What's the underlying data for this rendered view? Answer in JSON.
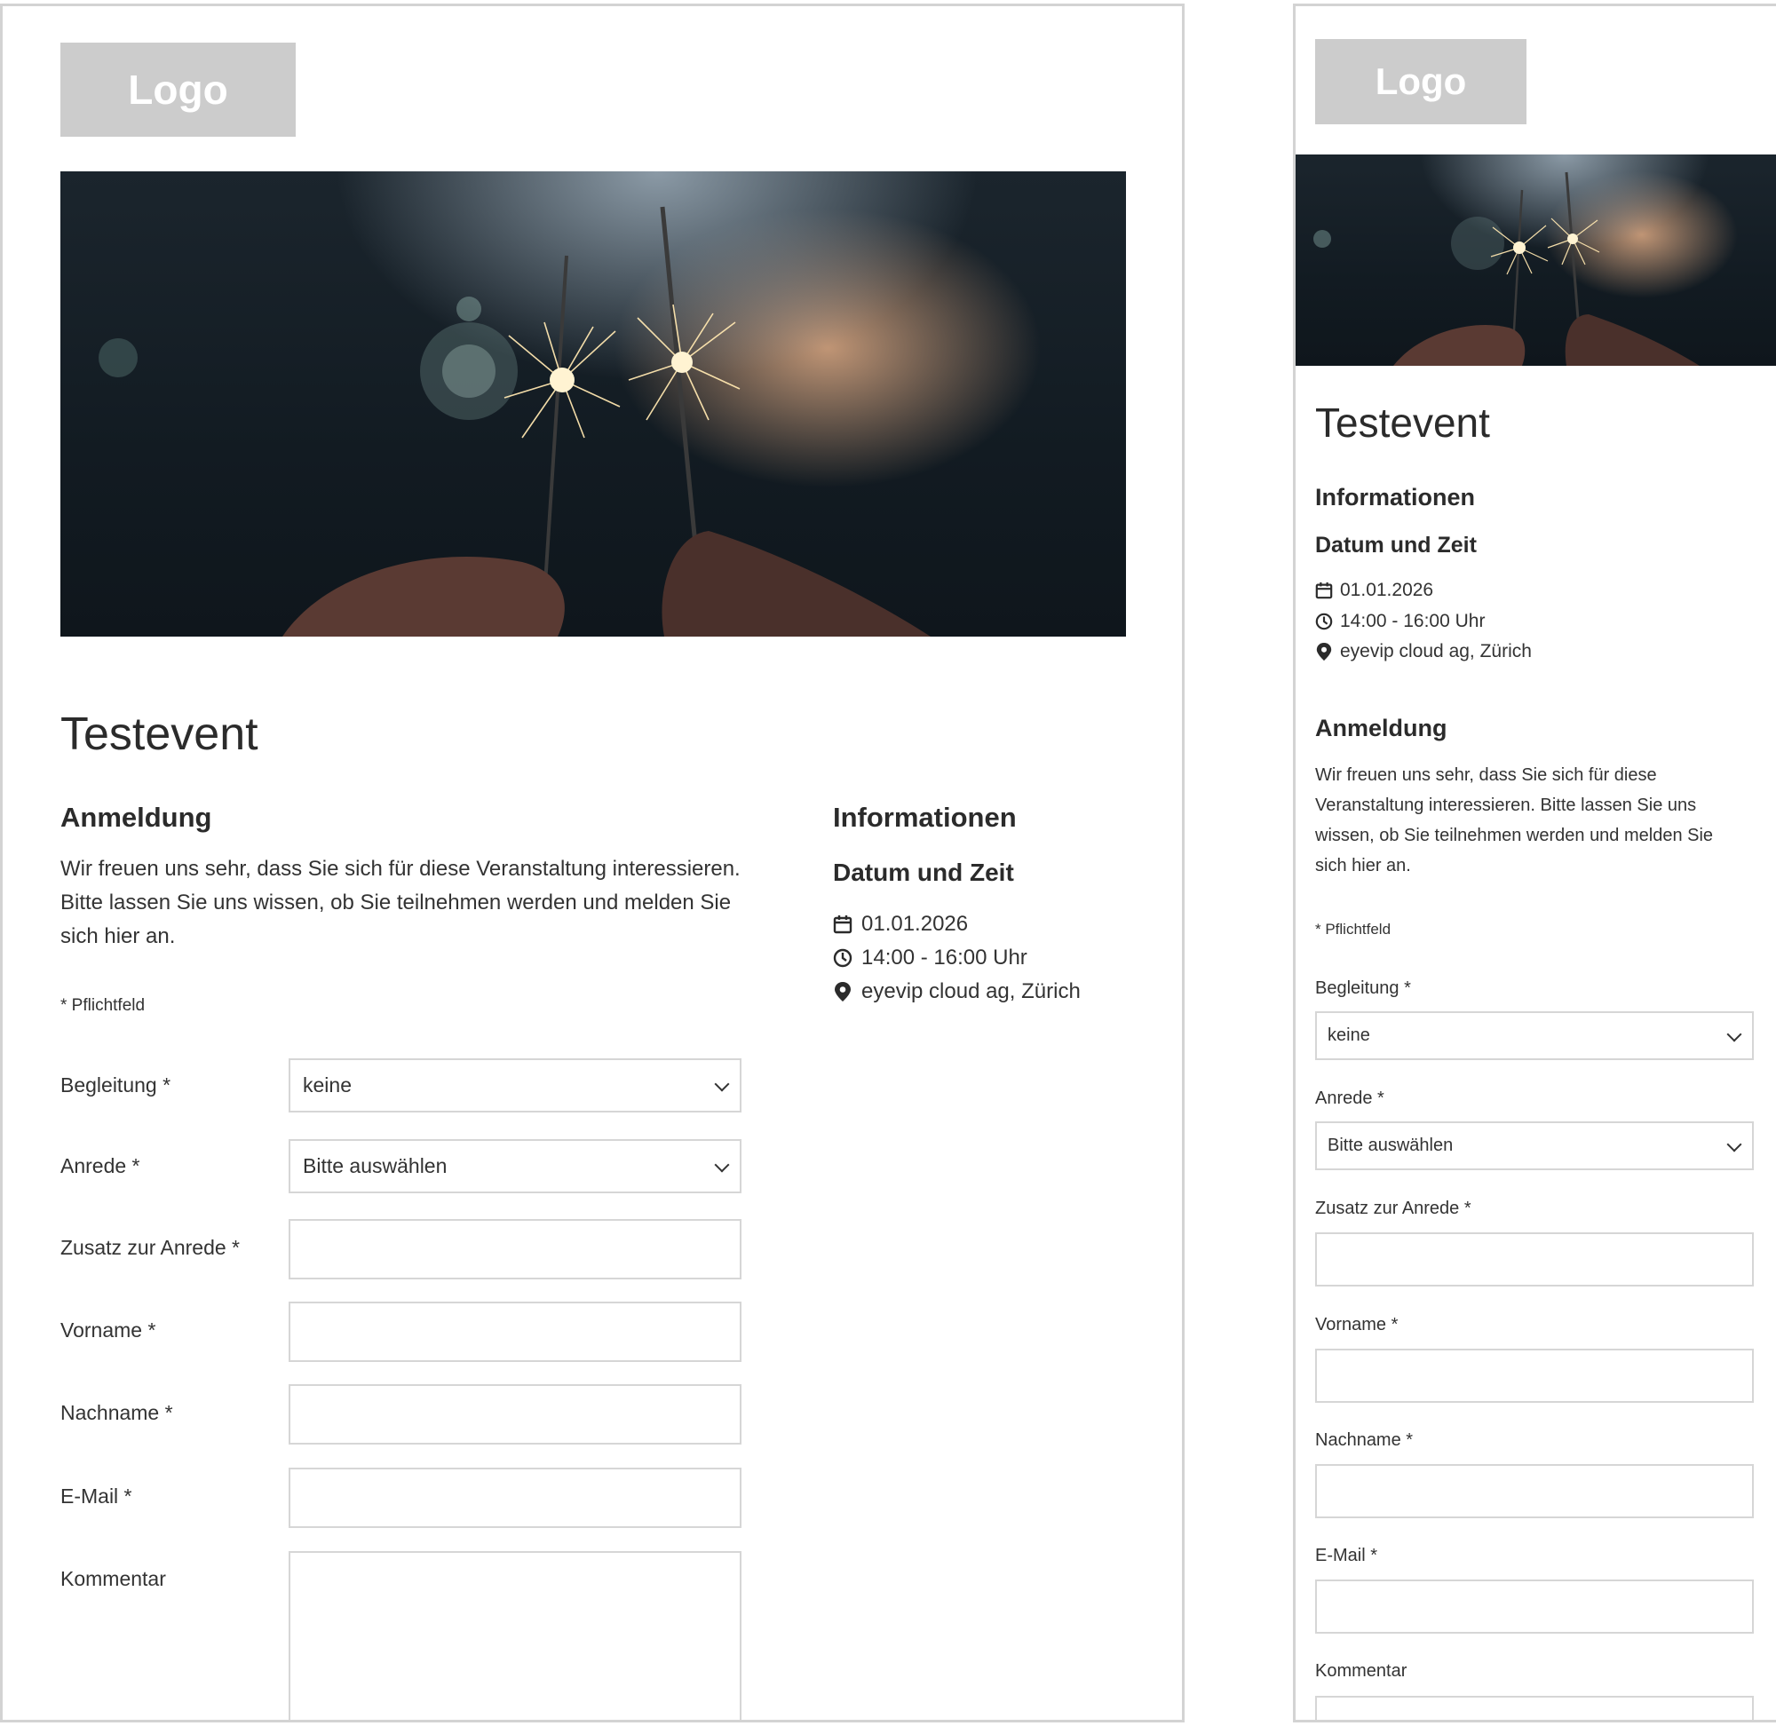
{
  "logo": {
    "text": "Logo"
  },
  "event": {
    "title": "Testevent"
  },
  "registration": {
    "heading": "Anmeldung",
    "text_desktop_lines": [
      "Wir freuen uns sehr, dass Sie sich für diese Veranstaltung interessieren.",
      "Bitte lassen Sie uns wissen, ob Sie teilnehmen werden und melden Sie",
      "sich hier an."
    ],
    "text_mobile_lines": [
      "Wir freuen uns sehr, dass Sie sich für diese",
      "Veranstaltung interessieren. Bitte lassen Sie uns",
      "wissen, ob Sie teilnehmen werden und melden Sie",
      "sich hier an."
    ],
    "required_note": "* Pflichtfeld"
  },
  "info": {
    "heading": "Informationen",
    "subheading": "Datum und Zeit",
    "date": "01.01.2026",
    "time": "14:00 - 16:00 Uhr",
    "location": "eyevip cloud ag, Zürich"
  },
  "form": {
    "begleitung": {
      "label": "Begleitung *",
      "value": "keine"
    },
    "anrede": {
      "label": "Anrede *",
      "value": "Bitte auswählen"
    },
    "zusatz": {
      "label": "Zusatz zur Anrede *"
    },
    "vorname": {
      "label": "Vorname *"
    },
    "nachname": {
      "label": "Nachname *"
    },
    "email": {
      "label": "E-Mail *"
    },
    "kommentar": {
      "label": "Kommentar"
    }
  },
  "icons": {
    "calendar": "calendar-icon",
    "clock": "clock-icon",
    "location": "map-pin-icon",
    "dropdown": "chevron-down-icon"
  },
  "colors": {
    "logo_bg": "#cccccc",
    "border": "#d6d6d6",
    "text": "#2b2b2b"
  }
}
